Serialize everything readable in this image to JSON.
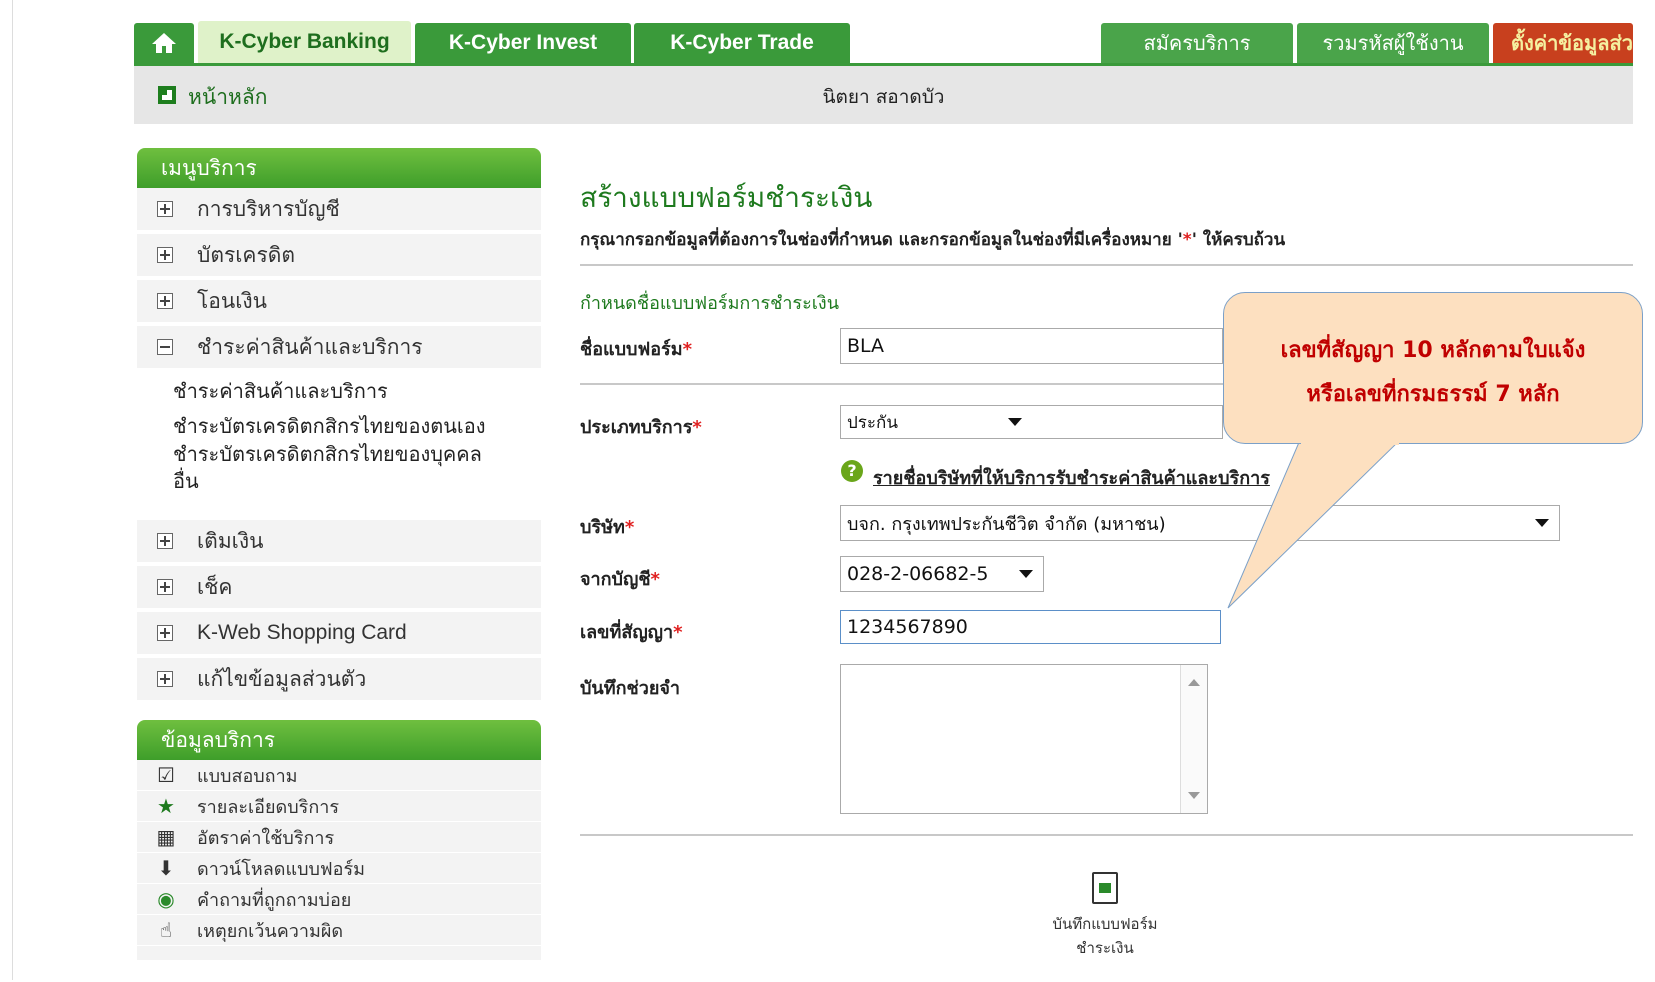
{
  "tabs": {
    "home_icon": "home-icon",
    "kbank": "K-Cyber Banking",
    "kinvest": "K-Cyber Invest",
    "ktrade": "K-Cyber Trade",
    "register": "สมัครบริการ",
    "combine": "รวมรหัสผู้ใช้งาน",
    "settings": "ตั้งค่าข้อมูลส่ว"
  },
  "crumb": {
    "home": "หน้าหลัก",
    "user": "นิตยา สอาดบัว"
  },
  "menu": {
    "title": "เมนูบริการ",
    "items": [
      {
        "label": "การบริหารบัญชี",
        "expanded": false
      },
      {
        "label": "บัตรเครดิต",
        "expanded": false
      },
      {
        "label": "โอนเงิน",
        "expanded": false
      },
      {
        "label": "ชำระค่าสินค้าและบริการ",
        "expanded": true
      },
      {
        "label": "เติมเงิน",
        "expanded": false
      },
      {
        "label": "เช็ค",
        "expanded": false
      },
      {
        "label": "K-Web Shopping Card",
        "expanded": false
      },
      {
        "label": "แก้ไขข้อมูลส่วนตัว",
        "expanded": false
      }
    ],
    "sub_items": [
      "ชำระค่าสินค้าและบริการ",
      "ชำระบัตรเครดิตกสิกรไทยของตนเอง",
      "ชำระบัตรเครดิตกสิกรไทยของบุคคล",
      "อื่น"
    ]
  },
  "info": {
    "title": "ข้อมูลบริการ",
    "items": [
      {
        "label": "แบบสอบถาม",
        "icon": "checkbox-icon"
      },
      {
        "label": "รายละเอียดบริการ",
        "icon": "star-icon"
      },
      {
        "label": "อัตราค่าใช้บริการ",
        "icon": "calculator-icon"
      },
      {
        "label": "ดาวน์โหลดแบบฟอร์ม",
        "icon": "download-icon"
      },
      {
        "label": "คำถามที่ถูกถามบ่อย",
        "icon": "faq-icon"
      },
      {
        "label": "เหตุยกเว้นความผิด",
        "icon": "hand-icon"
      }
    ]
  },
  "form": {
    "title": "สร้างแบบฟอร์มชำระเงิน",
    "desc_prefix": "กรุณากรอกข้อมูลที่ต้องการในช่องที่กำหนด และกรอกข้อมูลในช่องที่มีเครื่องหมาย '",
    "desc_star": "*",
    "desc_suffix": "' ให้ครบถ้วน",
    "section": "กำหนดชื่อแบบฟอร์มการชำระเงิน",
    "required_mark": "*",
    "form_name_label": "ชื่อแบบฟอร์ม",
    "form_name_value": "BLA",
    "service_type_label": "ประเภทบริการ",
    "service_type_value": "ประกัน",
    "provider_link": "รายชื่อบริษัทที่ให้บริการรับชำระค่าสินค้าและบริการ",
    "company_label": "บริษัท",
    "company_value": "บจก. กรุงเทพประกันชีวิต จำกัด (มหาชน)",
    "account_label": "จากบัญชี",
    "account_value": "028-2-06682-5",
    "contract_label": "เลขที่สัญญา",
    "contract_value": "1234567890",
    "memo_label": "บันทึกช่วยจำ",
    "memo_value": "",
    "save_line1": "บันทึกแบบฟอร์ม",
    "save_line2": "ชำระเงิน"
  },
  "callout": {
    "line1": "เลขที่สัญญา 10 หลักตามใบแจ้ง",
    "line2": "หรือเลขที่กรมธรรม์  7  หลัก"
  },
  "colors": {
    "brand_green": "#3a9a3a",
    "active_tab": "#dff2c9",
    "settings_tab": "#c8401e",
    "title_green": "#1e7a1e",
    "required_red": "#e02020",
    "callout_fill": "#fde0c0",
    "callout_text": "#c00000"
  }
}
